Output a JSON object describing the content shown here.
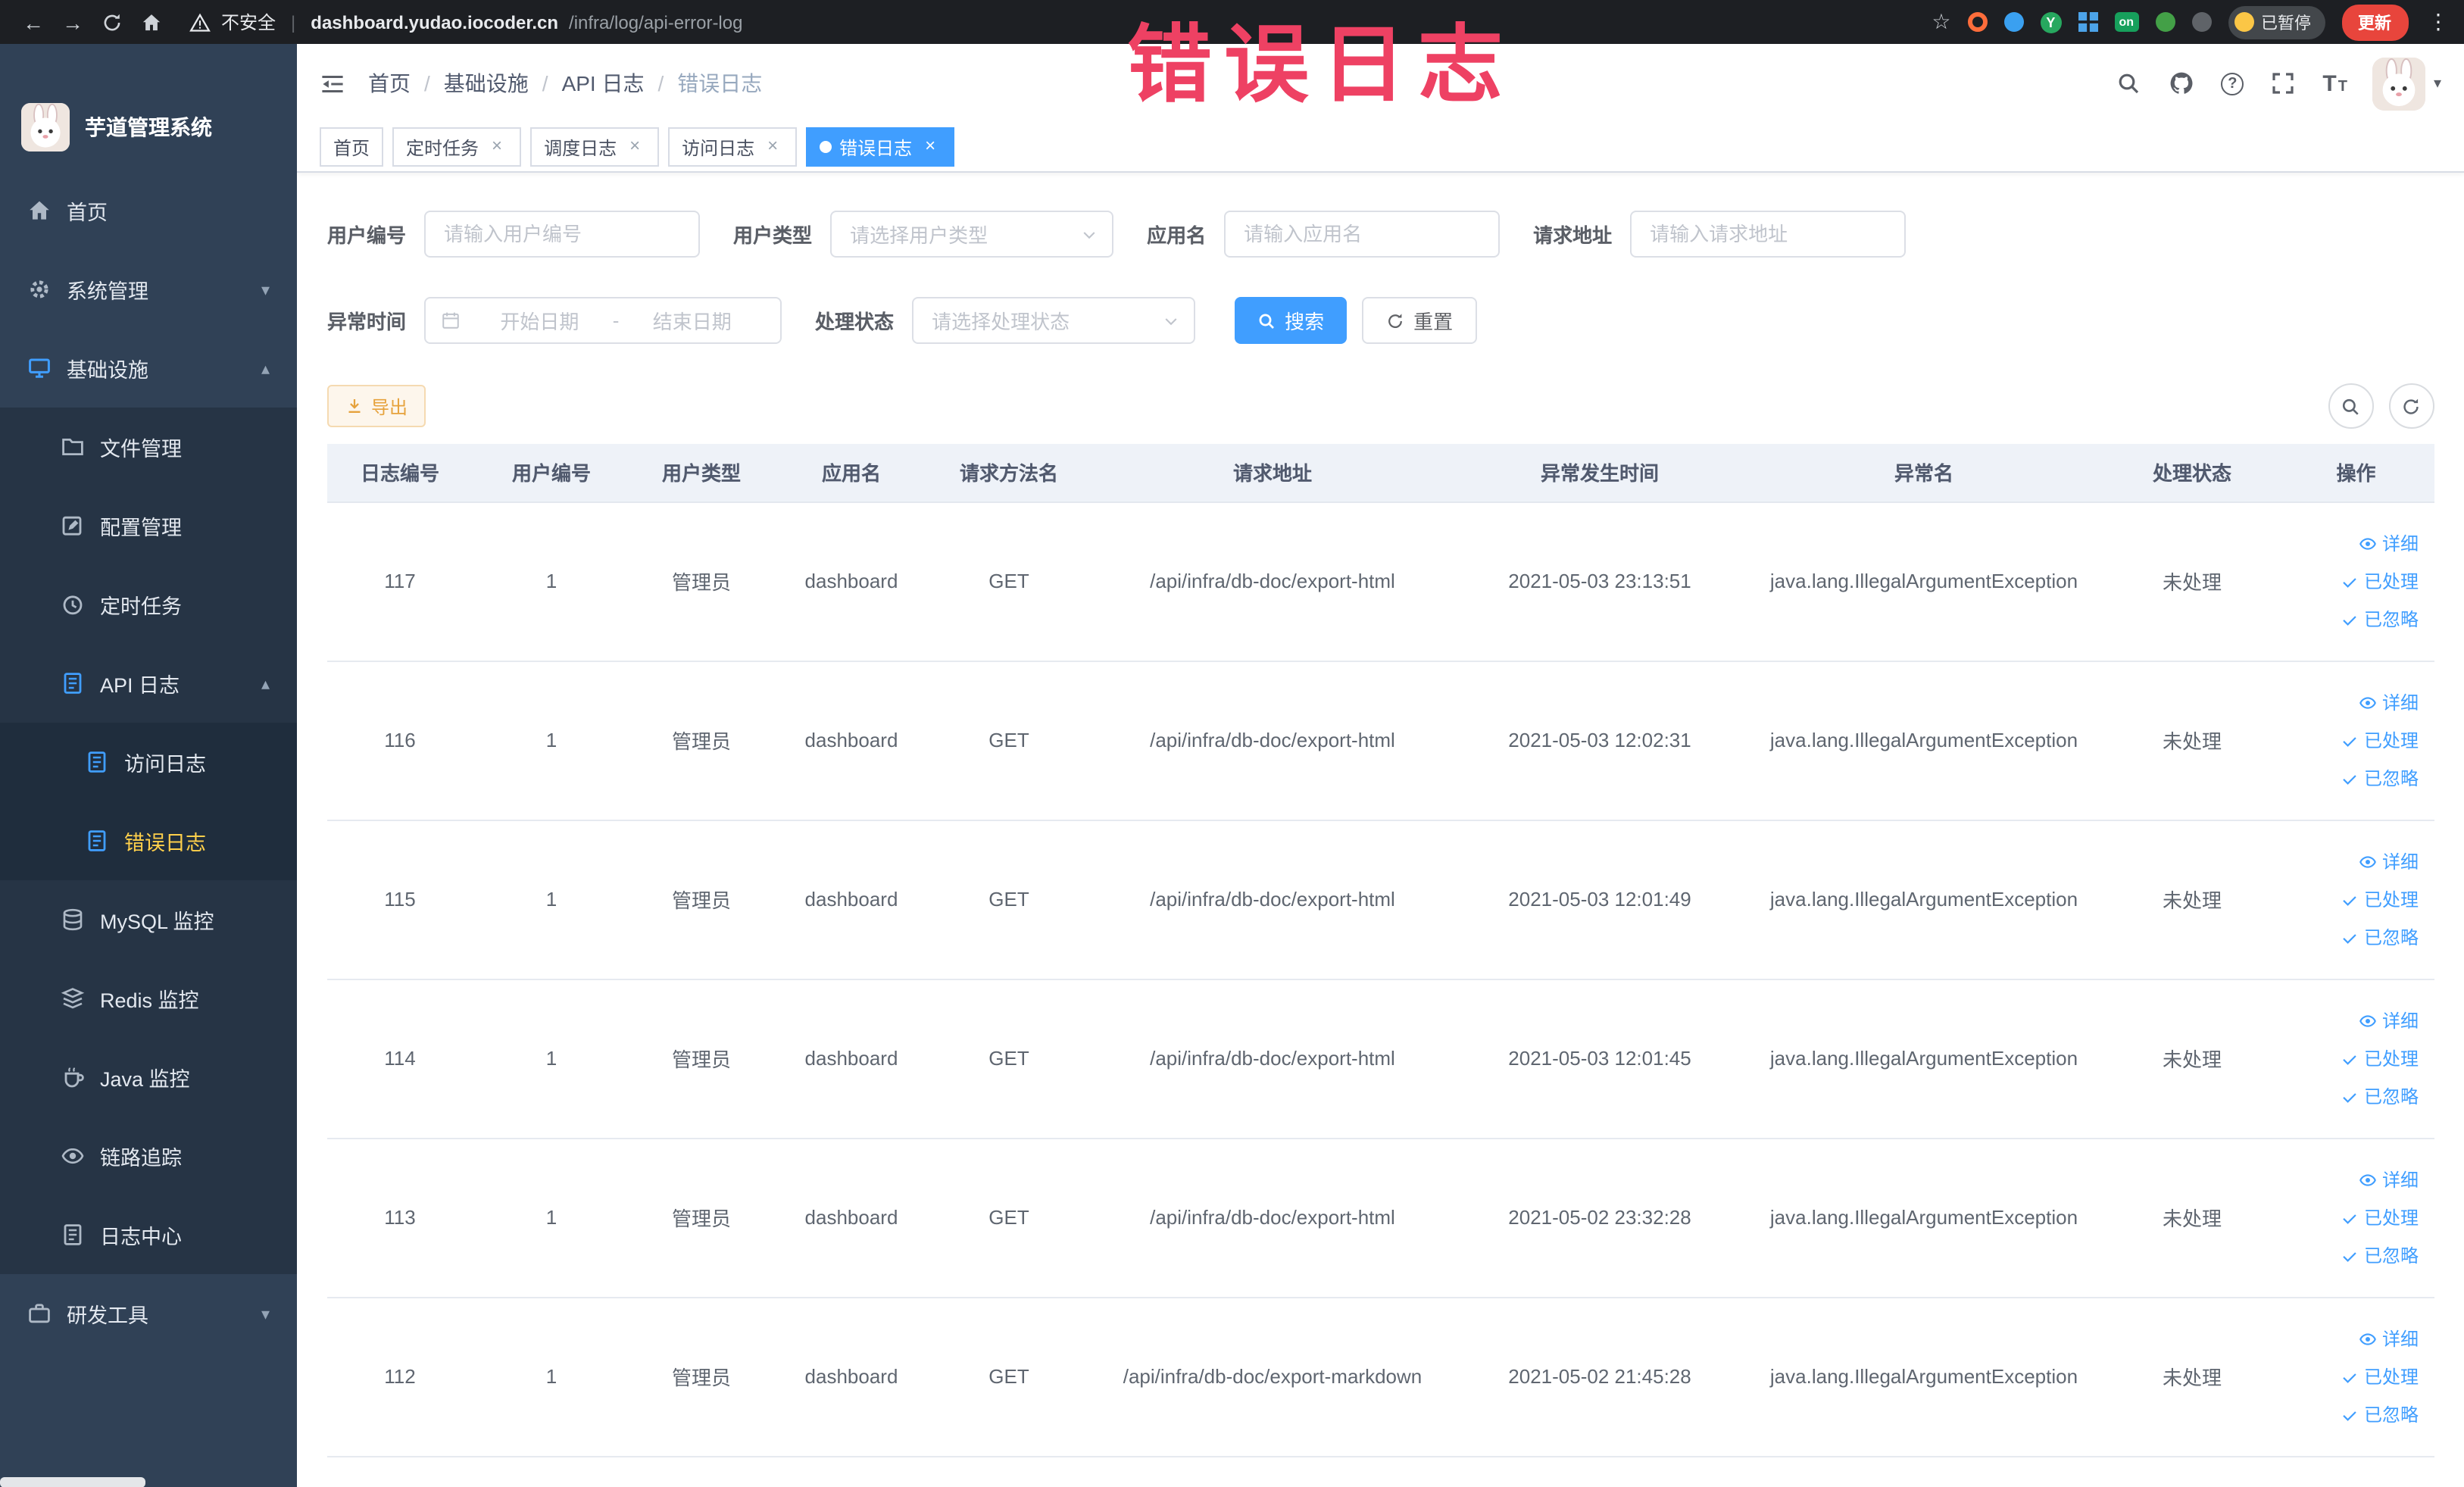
{
  "browser": {
    "security_label": "不安全",
    "url_host": "dashboard.yudao.iocoder.cn",
    "url_path": "/infra/log/api-error-log",
    "paused_badge": "已暂停",
    "update_button": "更新",
    "ext_y": "Y",
    "ext_on": "on"
  },
  "glyphs": {
    "back": "←",
    "forward": "→",
    "star": "☆",
    "menu_dots": "⋮",
    "close": "×",
    "chevron_down": "▾",
    "chevron_up": "▴",
    "caret_down": "▾",
    "slash": "/",
    "question": "?",
    "font_size": "T",
    "pipe": "|"
  },
  "watermark": "错误日志",
  "sidebar": {
    "logo_title": "芋道管理系统",
    "items": [
      {
        "label": "首页",
        "icon": "home-icon",
        "level": 1
      },
      {
        "label": "系统管理",
        "icon": "gear-icon",
        "level": 1,
        "chevron": "down"
      },
      {
        "label": "基础设施",
        "icon": "infrastructure-icon",
        "level": 1,
        "chevron": "up",
        "expanded": true
      },
      {
        "label": "文件管理",
        "icon": "file-management-icon",
        "level": 2
      },
      {
        "label": "配置管理",
        "icon": "config-management-icon",
        "level": 2
      },
      {
        "label": "定时任务",
        "icon": "scheduled-task-icon",
        "level": 2
      },
      {
        "label": "API 日志",
        "icon": "api-log-icon",
        "level": 2,
        "chevron": "up",
        "expanded": true
      },
      {
        "label": "访问日志",
        "icon": "access-log-icon",
        "level": 3
      },
      {
        "label": "错误日志",
        "icon": "error-log-icon",
        "level": 3,
        "active": true
      },
      {
        "label": "MySQL 监控",
        "icon": "mysql-monitor-icon",
        "level": 2
      },
      {
        "label": "Redis 监控",
        "icon": "redis-monitor-icon",
        "level": 2
      },
      {
        "label": "Java 监控",
        "icon": "java-monitor-icon",
        "level": 2
      },
      {
        "label": "链路追踪",
        "icon": "trace-icon",
        "level": 2
      },
      {
        "label": "日志中心",
        "icon": "log-center-icon",
        "level": 2
      },
      {
        "label": "研发工具",
        "icon": "devtools-icon",
        "level": 1,
        "chevron": "down"
      }
    ]
  },
  "header": {
    "breadcrumb": [
      "首页",
      "基础设施",
      "API 日志",
      "错误日志"
    ]
  },
  "tabs": [
    {
      "label": "首页",
      "closable": false,
      "active": false
    },
    {
      "label": "定时任务",
      "closable": true,
      "active": false
    },
    {
      "label": "调度日志",
      "closable": true,
      "active": false
    },
    {
      "label": "访问日志",
      "closable": true,
      "active": false
    },
    {
      "label": "错误日志",
      "closable": true,
      "active": true
    }
  ],
  "filters": {
    "user_id_label": "用户编号",
    "user_id_placeholder": "请输入用户编号",
    "user_type_label": "用户类型",
    "user_type_placeholder": "请选择用户类型",
    "app_name_label": "应用名",
    "app_name_placeholder": "请输入应用名",
    "request_url_label": "请求地址",
    "request_url_placeholder": "请输入请求地址",
    "exception_time_label": "异常时间",
    "date_start_placeholder": "开始日期",
    "date_separator": "-",
    "date_end_placeholder": "结束日期",
    "process_status_label": "处理状态",
    "process_status_placeholder": "请选择处理状态",
    "search_button": "搜索",
    "reset_button": "重置"
  },
  "toolbar": {
    "export_label": "导出"
  },
  "table": {
    "columns": [
      "日志编号",
      "用户编号",
      "用户类型",
      "应用名",
      "请求方法名",
      "请求地址",
      "异常发生时间",
      "异常名",
      "处理状态",
      "操作"
    ],
    "column_keys": [
      "log_id",
      "user_id",
      "user_type",
      "app_name",
      "method",
      "url",
      "time",
      "exception",
      "status"
    ],
    "actions": {
      "detail": "详细",
      "processed": "已处理",
      "ignored": "已忽略"
    },
    "rows": [
      {
        "log_id": "117",
        "user_id": "1",
        "user_type": "管理员",
        "app_name": "dashboard",
        "method": "GET",
        "url": "/api/infra/db-doc/export-html",
        "time": "2021-05-03 23:13:51",
        "exception": "java.lang.IllegalArgumentException",
        "status": "未处理"
      },
      {
        "log_id": "116",
        "user_id": "1",
        "user_type": "管理员",
        "app_name": "dashboard",
        "method": "GET",
        "url": "/api/infra/db-doc/export-html",
        "time": "2021-05-03 12:02:31",
        "exception": "java.lang.IllegalArgumentException",
        "status": "未处理"
      },
      {
        "log_id": "115",
        "user_id": "1",
        "user_type": "管理员",
        "app_name": "dashboard",
        "method": "GET",
        "url": "/api/infra/db-doc/export-html",
        "time": "2021-05-03 12:01:49",
        "exception": "java.lang.IllegalArgumentException",
        "status": "未处理"
      },
      {
        "log_id": "114",
        "user_id": "1",
        "user_type": "管理员",
        "app_name": "dashboard",
        "method": "GET",
        "url": "/api/infra/db-doc/export-html",
        "time": "2021-05-03 12:01:45",
        "exception": "java.lang.IllegalArgumentException",
        "status": "未处理"
      },
      {
        "log_id": "113",
        "user_id": "1",
        "user_type": "管理员",
        "app_name": "dashboard",
        "method": "GET",
        "url": "/api/infra/db-doc/export-html",
        "time": "2021-05-02 23:32:28",
        "exception": "java.lang.IllegalArgumentException",
        "status": "未处理"
      },
      {
        "log_id": "112",
        "user_id": "1",
        "user_type": "管理员",
        "app_name": "dashboard",
        "method": "GET",
        "url": "/api/infra/db-doc/export-markdown",
        "time": "2021-05-02 21:45:28",
        "exception": "java.lang.IllegalArgumentException",
        "status": "未处理"
      }
    ]
  },
  "colors": {
    "accent": "#409eff",
    "warning": "#e6a23c",
    "watermark": "#ee4163",
    "sidebar_bg": "#304156",
    "active_menu_text": "#ffd04b",
    "table_header_bg": "#eef2f8"
  }
}
